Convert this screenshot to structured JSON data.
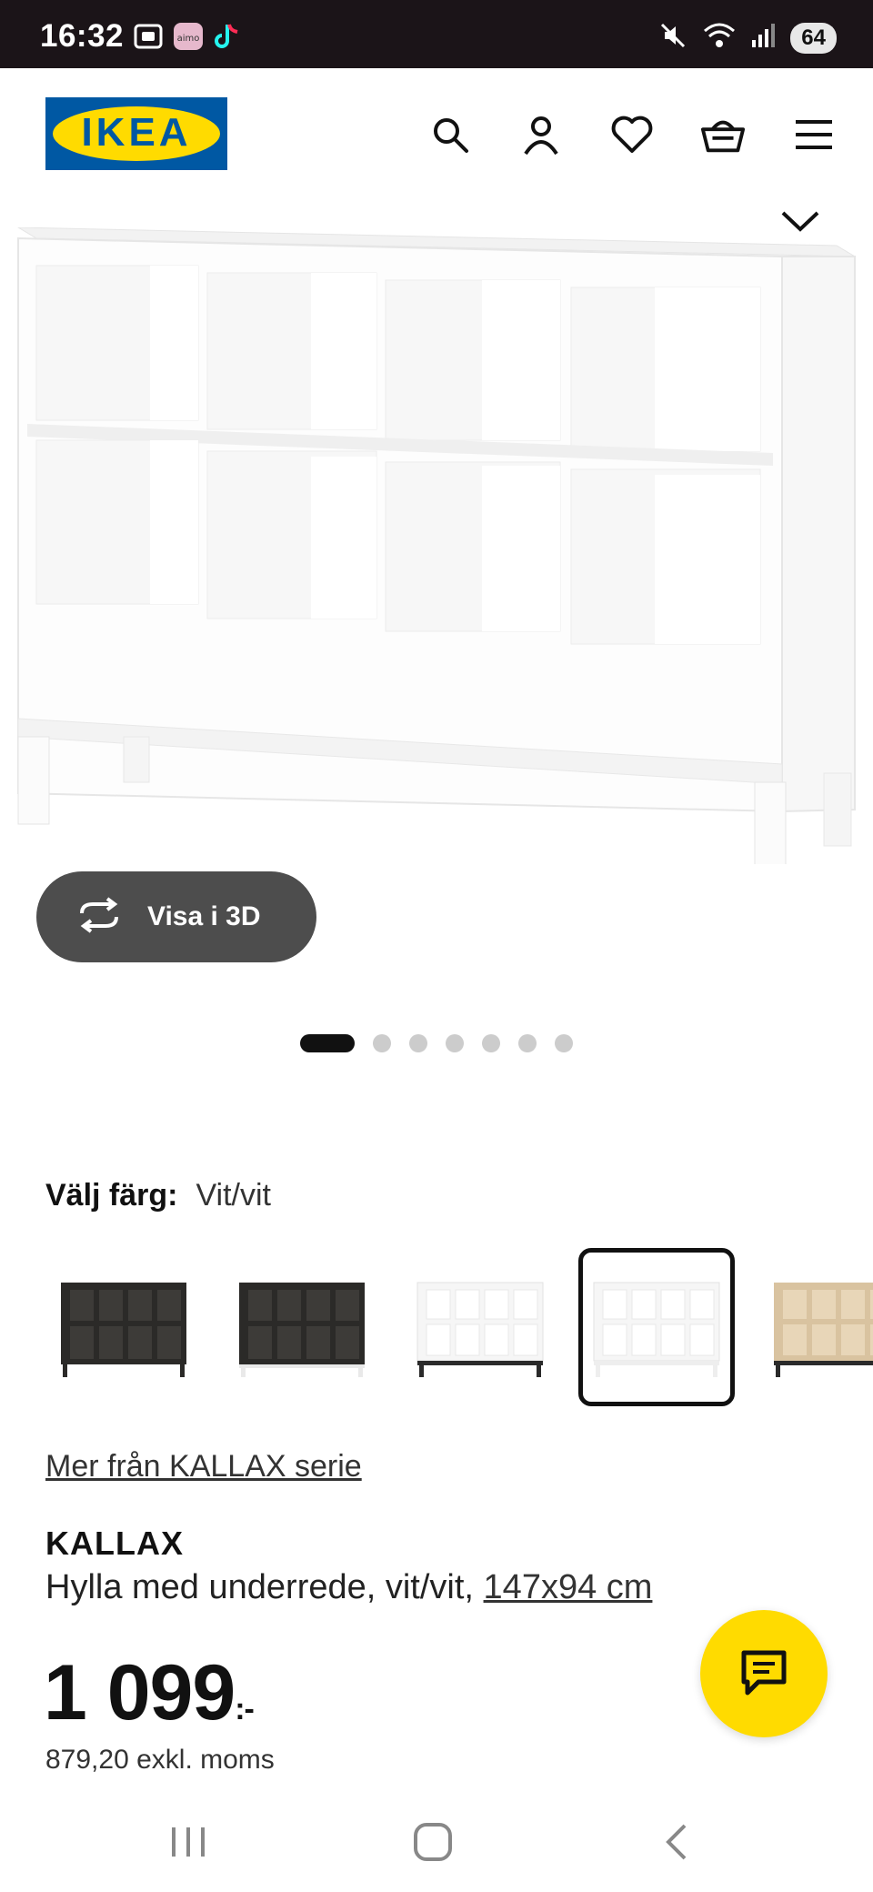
{
  "status_bar": {
    "time": "16:32",
    "battery": "64",
    "left_icons": [
      "screenshot-icon",
      "aimo-icon",
      "tiktok-icon"
    ],
    "right_icons": [
      "mute-icon",
      "wifi-icon",
      "signal-icon"
    ]
  },
  "header": {
    "logo_text": "IKEA",
    "icons": [
      "search-icon",
      "account-icon",
      "heart-icon",
      "basket-icon",
      "menu-icon"
    ]
  },
  "hero": {
    "visa_3d_label": "Visa i 3D",
    "carousel": {
      "total": 7,
      "active": 1
    }
  },
  "color_chooser": {
    "label": "Välj färg:",
    "value": "Vit/vit",
    "swatches": [
      {
        "name": "black-brown",
        "selected": false
      },
      {
        "name": "black-brown-white",
        "selected": false
      },
      {
        "name": "white-black",
        "selected": false
      },
      {
        "name": "white-white",
        "selected": true
      },
      {
        "name": "oak",
        "selected": false
      }
    ]
  },
  "product": {
    "series_link": "Mer från KALLAX serie",
    "name": "KALLAX",
    "description": "Hylla med underrede, vit/vit,",
    "dimensions": "147x94 cm",
    "price": "1 099",
    "price_suffix": ":-",
    "price_ex_vat": "879,20 exkl. moms"
  },
  "colors": {
    "ikea_blue": "#0058a3",
    "ikea_yellow": "#ffdb00",
    "button_dark": "#4d4d4d"
  }
}
